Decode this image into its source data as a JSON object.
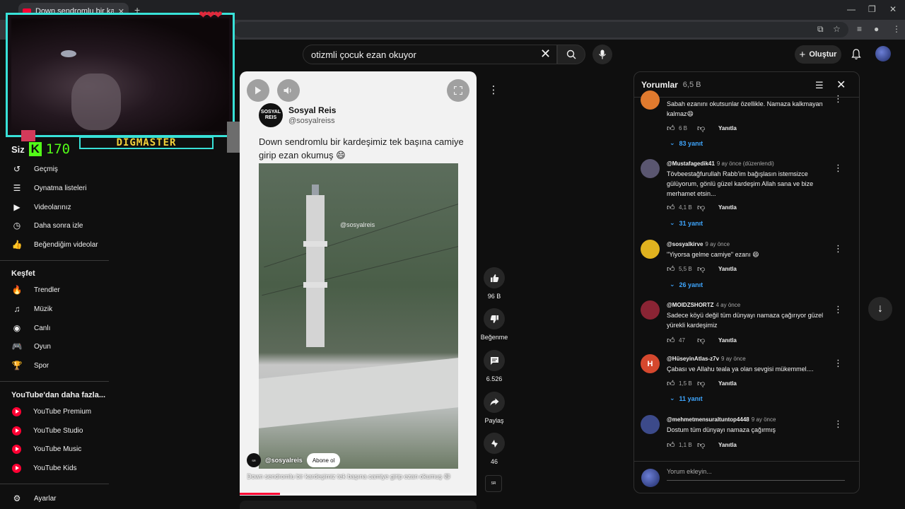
{
  "browser": {
    "tab_title": "Down sendromlu bir karde",
    "tab_close": "✕",
    "new_tab": "+"
  },
  "masthead": {
    "search_value": "otizmli çocuk ezan okuyor",
    "create_label": "Oluştur"
  },
  "overlay": {
    "kick_label": "Siz",
    "kick_count": "170",
    "streamer_name": "DIGMASTER"
  },
  "sidebar": {
    "you_items": [
      {
        "label": "Geçmiş",
        "icon": "history-icon"
      },
      {
        "label": "Oynatma listeleri",
        "icon": "playlist-icon"
      },
      {
        "label": "Videolarınız",
        "icon": "your-videos-icon"
      },
      {
        "label": "Daha sonra izle",
        "icon": "watch-later-icon"
      },
      {
        "label": "Beğendiğim videolar",
        "icon": "liked-videos-icon"
      }
    ],
    "explore_title": "Keşfet",
    "explore_items": [
      {
        "label": "Trendler",
        "icon": "trending-icon"
      },
      {
        "label": "Müzik",
        "icon": "music-icon"
      },
      {
        "label": "Canlı",
        "icon": "live-icon"
      },
      {
        "label": "Oyun",
        "icon": "gaming-icon"
      },
      {
        "label": "Spor",
        "icon": "trophy-icon"
      }
    ],
    "more_title": "YouTube'dan daha fazla...",
    "more_items": [
      {
        "label": "YouTube Premium"
      },
      {
        "label": "YouTube Studio"
      },
      {
        "label": "YouTube Music"
      },
      {
        "label": "YouTube Kids"
      }
    ],
    "settings_label": "Ayarlar"
  },
  "short": {
    "account_name": "Sosyal Reis",
    "account_handle": "@sosyalreiss",
    "logo_text": "SOSYAL REIS",
    "tweet_text": "Down sendromlu bir kardeşimiz tek başına camiye girip ezan okumuş 😄",
    "watermark": "@sosyalreis",
    "channel": "@sosyalreis",
    "subscribe_label": "Abone ol",
    "caption": "Down sendromlu bir kardeşimiz tek başına camiye girip ezan okumuş 😄",
    "progress": 0.17
  },
  "actions": {
    "likes": "96 B",
    "dislike_label": "Beğenme",
    "comments_count": "6.526",
    "share_label": "Paylaş",
    "remix_count": "46"
  },
  "comments": {
    "title": "Yorumlar",
    "count": "6,5 B",
    "reply_label": "Yanıtla",
    "add_placeholder": "Yorum ekleyin...",
    "items": [
      {
        "author": "",
        "time": "",
        "text": "Sabah ezanını okutsunlar özellikle. Namaza kalkmayan kalmaz😄",
        "likes": "6 B",
        "replies": "83 yanıt",
        "avatar_color": "#e07a2e",
        "avatar_letter": ""
      },
      {
        "author": "@Mustafagedik41",
        "time": "9 ay önce (düzenlendi)",
        "text": "Tövbeestağfurullah Rabb'im bağışlasın istemsizce gülüyorum, gönlü güzel kardeşim Allah sana ve bize merhamet etsin...",
        "likes": "4,1 B",
        "replies": "31 yanıt",
        "avatar_color": "#5a5670",
        "avatar_letter": ""
      },
      {
        "author": "@sosyalkirve",
        "time": "9 ay önce",
        "text": "\"Yiyorsa gelme camiye\" ezanı 😄",
        "likes": "5,5 B",
        "replies": "26 yanıt",
        "avatar_color": "#e0b21f",
        "avatar_letter": ""
      },
      {
        "author": "@MOIDZSHORTZ",
        "time": "4 ay önce",
        "text": "Sadece köyü değil tüm dünyayı namaza çağırıyor güzel yürekli kardeşimiz",
        "likes": "47",
        "replies": "",
        "avatar_color": "#8a2434",
        "avatar_letter": ""
      },
      {
        "author": "@HüseyinAtlas-z7v",
        "time": "9 ay önce",
        "text": "Çabası ve Allahu teala ya olan sevgisi mükemmel....",
        "likes": "1,5 B",
        "replies": "11 yanıt",
        "avatar_color": "#d5482e",
        "avatar_letter": "H"
      },
      {
        "author": "@mehmetmensuraltuntop4448",
        "time": "9 ay önce",
        "text": "Dostum tüm dünyayı namaza çağırmış",
        "likes": "1,1 B",
        "replies": "",
        "avatar_color": "#3c4a8a",
        "avatar_letter": ""
      }
    ]
  }
}
